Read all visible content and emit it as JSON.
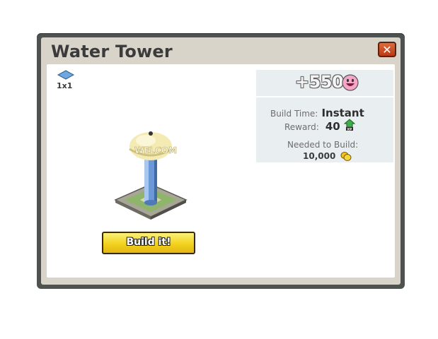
{
  "dialog": {
    "title": "Water Tower",
    "close_label": "✕"
  },
  "item": {
    "size_label": "1x1",
    "build_button_label": "Build it!"
  },
  "info": {
    "xp_bonus": "+550",
    "build_time_label": "Build Time:",
    "build_time_value": "Instant",
    "reward_label": "Reward:",
    "reward_value": "40",
    "needed_label": "Needed to Build:",
    "cost_value": "10,000"
  },
  "colors": {
    "frame": "#4e5250",
    "header": "#d8d4c9",
    "button_yellow": "#f2d21c",
    "close_red": "#c9481f",
    "info_panel": "#e9eef1"
  },
  "icons": [
    "close-icon",
    "tile-size-icon",
    "smiley-icon",
    "xp-icon",
    "coin-icon"
  ]
}
